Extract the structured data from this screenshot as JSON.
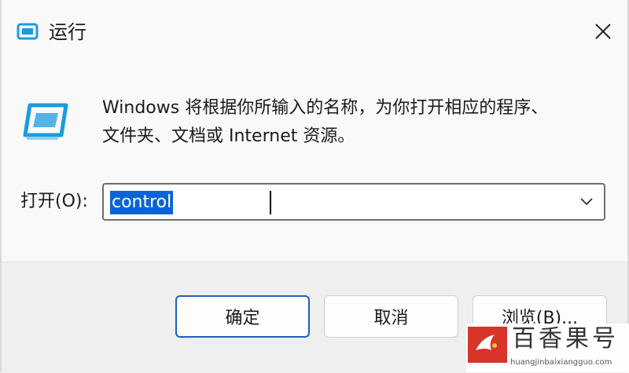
{
  "window": {
    "title": "运行",
    "icon": "run-dialog-icon",
    "close_icon": "close-icon"
  },
  "description": {
    "line1": "Windows 将根据你所输入的名称，为你打开相应的程序、",
    "line2": "文件夹、文档或 Internet 资源。"
  },
  "open_field": {
    "label": "打开(O):",
    "value": "control",
    "dropdown_icon": "chevron-down-icon"
  },
  "buttons": {
    "ok": "确定",
    "cancel": "取消",
    "browse": "浏览(B)..."
  },
  "watermark": {
    "text": "百香果号",
    "url": "huangjinbaixiangguo.com",
    "logo": "watermark-logo"
  },
  "colors": {
    "accent": "#1f5fbf",
    "selection": "#0a64d6",
    "icon_blue": "#1a9be0"
  }
}
